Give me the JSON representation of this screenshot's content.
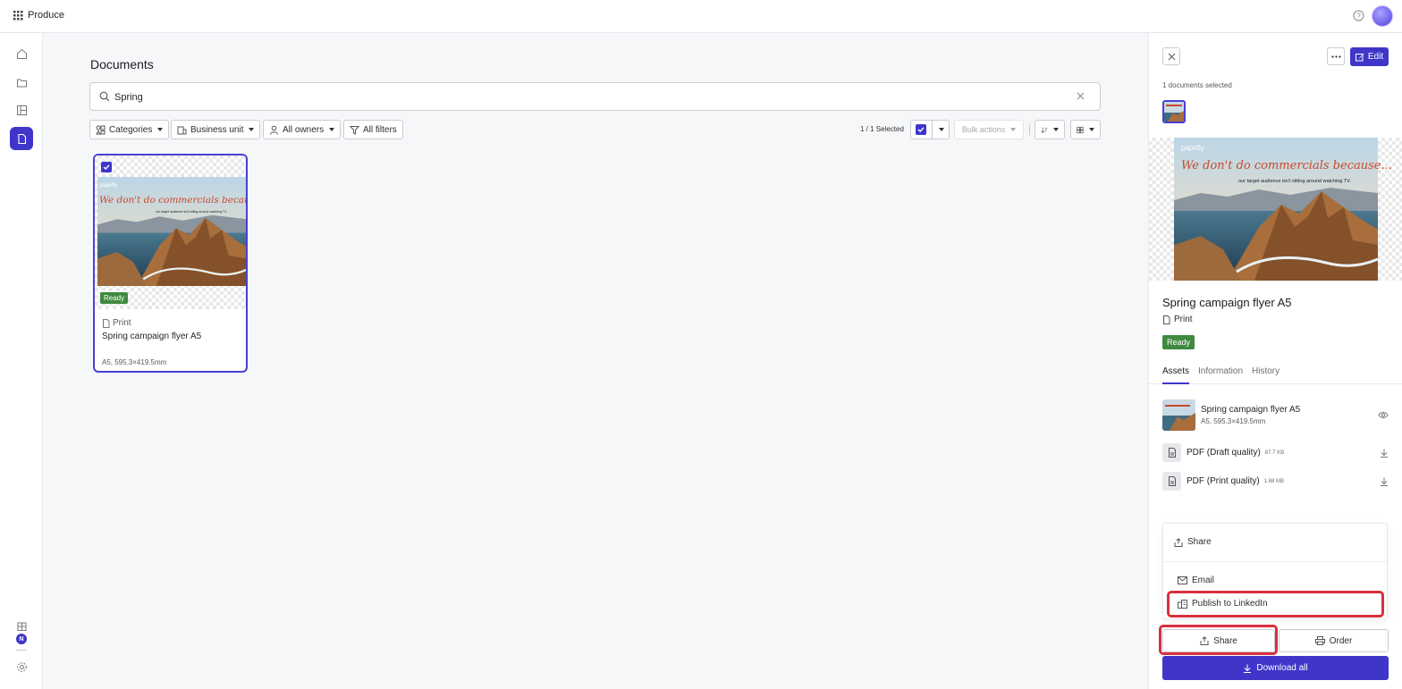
{
  "app": {
    "name": "Produce"
  },
  "main": {
    "title": "Documents",
    "search": {
      "value": "Spring",
      "placeholder": "Search"
    },
    "filters": [
      {
        "label": "Categories",
        "icon": "categories-icon"
      },
      {
        "label": "Business unit",
        "icon": "business-unit-icon"
      },
      {
        "label": "All owners",
        "icon": "owner-icon"
      },
      {
        "label": "All filters",
        "icon": "filter-icon"
      }
    ],
    "selection_count": "1 / 1 Selected",
    "bulk_actions": "Bulk actions",
    "card": {
      "flyer_brand": "papirfly",
      "flyer_headline": "We don't do commercials because...",
      "flyer_sub": "our target audience isn't sitting around watching TV.",
      "status": "Ready",
      "type": "Print",
      "title": "Spring campaign flyer A5",
      "dims": "A5, 595.3×419.5mm"
    }
  },
  "panel": {
    "selected_text": "1 documents selected",
    "edit_label": "Edit",
    "doc_title": "Spring campaign flyer A5",
    "doc_type": "Print",
    "status": "Ready",
    "tabs": [
      "Assets",
      "Information",
      "History"
    ],
    "assets": [
      {
        "name": "Spring campaign flyer A5",
        "sub": "A5, 595.3×419.5mm"
      },
      {
        "name": "PDF (Draft quality)",
        "size": "87.7 KB"
      },
      {
        "name": "PDF (Print quality)",
        "size": "1.68 MB"
      }
    ],
    "share_menu": {
      "header": "Share",
      "items": [
        "Email",
        "Publish to LinkedIn"
      ]
    },
    "share_label": "Share",
    "order_label": "Order",
    "download_label": "Download all"
  },
  "colors": {
    "accent": "#3f36c9",
    "ready": "#3f8a3f",
    "highlight": "#d92f3c"
  }
}
